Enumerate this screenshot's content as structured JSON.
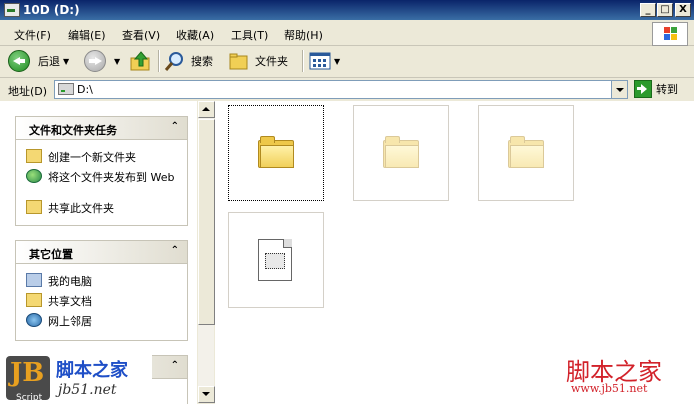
{
  "window": {
    "title": "10D (D:)"
  },
  "titlebar_buttons": {
    "minimize": "_",
    "maximize": "□",
    "close": "X"
  },
  "menu": [
    "文件(F)",
    "编辑(E)",
    "查看(V)",
    "收藏(A)",
    "工具(T)",
    "帮助(H)"
  ],
  "toolbar": {
    "back_label": "后退",
    "search_label": "搜索",
    "folders_label": "文件夹"
  },
  "address": {
    "label": "地址(D)",
    "value": "D:\\",
    "go_label": "转到"
  },
  "tasks_panel": {
    "title": "文件和文件夹任务",
    "collapse": "⌃",
    "items": [
      "创建一个新文件夹",
      "将这个文件夹发布到 Web",
      "共享此文件夹"
    ]
  },
  "places_panel": {
    "title": "其它位置",
    "collapse": "⌃",
    "items": [
      "我的电脑",
      "共享文档",
      "网上邻居"
    ]
  },
  "third_panel": {
    "collapse": "⌃"
  },
  "items": [
    {
      "type": "folder",
      "selected": true,
      "hidden": false
    },
    {
      "type": "folder",
      "selected": false,
      "hidden": true
    },
    {
      "type": "folder",
      "selected": false,
      "hidden": true
    },
    {
      "type": "file",
      "selected": false,
      "hidden": true
    }
  ],
  "watermark_left": {
    "brand": "脚本之家",
    "url": "jb51.net",
    "mark": "JB",
    "script": "Script"
  },
  "watermark_right": {
    "brand": "脚本之家",
    "url": "www.jb51.net"
  },
  "colors": {
    "titlebar": "#0a246a",
    "panel_bg": "#ffffff",
    "accent_green": "#2c9a2c",
    "watermark_red": "#d2222a",
    "watermark_blue": "#1f4fc7"
  }
}
